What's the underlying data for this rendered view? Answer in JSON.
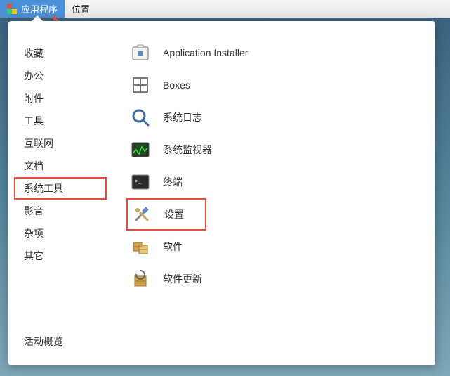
{
  "topbar": {
    "applications": "应用程序",
    "locations": "位置"
  },
  "sidebar": {
    "categories": [
      "收藏",
      "办公",
      "附件",
      "工具",
      "互联网",
      "文档",
      "系统工具",
      "影音",
      "杂项",
      "其它"
    ],
    "selected_index": 6,
    "overview": "活动概览"
  },
  "apps": [
    {
      "id": "installer",
      "label": "Application Installer"
    },
    {
      "id": "boxes",
      "label": "Boxes"
    },
    {
      "id": "logs",
      "label": "系统日志"
    },
    {
      "id": "monitor",
      "label": "系统监视器"
    },
    {
      "id": "terminal",
      "label": "终端"
    },
    {
      "id": "settings",
      "label": "设置"
    },
    {
      "id": "software",
      "label": "软件"
    },
    {
      "id": "updates",
      "label": "软件更新"
    }
  ],
  "highlighted_app_index": 5
}
